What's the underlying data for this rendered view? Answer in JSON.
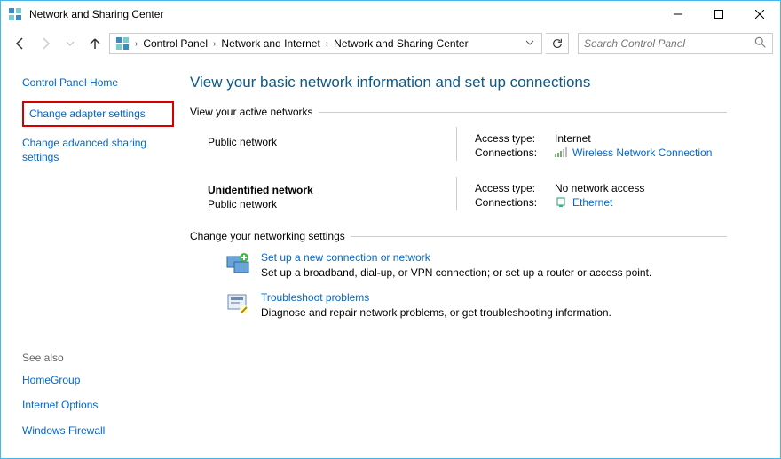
{
  "window": {
    "title": "Network and Sharing Center"
  },
  "breadcrumb": {
    "items": [
      "Control Panel",
      "Network and Internet",
      "Network and Sharing Center"
    ]
  },
  "search": {
    "placeholder": "Search Control Panel"
  },
  "sidebar": {
    "home": "Control Panel Home",
    "adapter": "Change adapter settings",
    "advanced": "Change advanced sharing settings",
    "seealso_hdr": "See also",
    "seealso": [
      "HomeGroup",
      "Internet Options",
      "Windows Firewall"
    ]
  },
  "main": {
    "heading": "View your basic network information and set up connections",
    "active_hdr": "View your active networks",
    "networks": [
      {
        "name": "",
        "type": "Public network",
        "access_label": "Access type:",
        "access_value": "Internet",
        "conn_label": "Connections:",
        "conn_value": "Wireless Network Connection",
        "icon": "wifi"
      },
      {
        "name": "Unidentified network",
        "type": "Public network",
        "access_label": "Access type:",
        "access_value": "No network access",
        "conn_label": "Connections:",
        "conn_value": "Ethernet",
        "icon": "ethernet"
      }
    ],
    "change_hdr": "Change your networking settings",
    "settings": [
      {
        "title": "Set up a new connection or network",
        "desc": "Set up a broadband, dial-up, or VPN connection; or set up a router or access point."
      },
      {
        "title": "Troubleshoot problems",
        "desc": "Diagnose and repair network problems, or get troubleshooting information."
      }
    ]
  }
}
